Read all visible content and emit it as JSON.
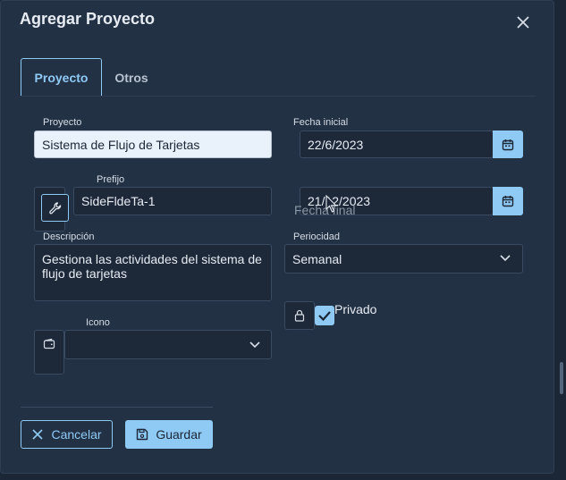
{
  "dialog": {
    "title": "Agregar Proyecto",
    "close_icon": "close-icon"
  },
  "tabs": [
    {
      "label": "Proyecto",
      "active": true
    },
    {
      "label": "Otros",
      "active": false
    }
  ],
  "form": {
    "project_label": "Proyecto",
    "project_value": "Sistema de Flujo de Tarjetas",
    "start_label": "Fecha inicial",
    "start_value": "22/6/2023",
    "prefix_label": "Prefijo",
    "prefix_value": "SideFldeTa-1",
    "end_label": "Fecha final",
    "end_value": "21/12/2023",
    "desc_label": "Descripción",
    "desc_value": "Gestiona las actividades del sistema de flujo de tarjetas",
    "periodicity_label": "Periocidad",
    "periodicity_value": "Semanal",
    "private_label": "Privado",
    "private_checked": true,
    "icon_label": "Icono",
    "icon_value": ""
  },
  "actions": {
    "cancel_label": "Cancelar",
    "save_label": "Guardar"
  },
  "colors": {
    "accent": "#8fcaf5",
    "background": "#233145"
  }
}
